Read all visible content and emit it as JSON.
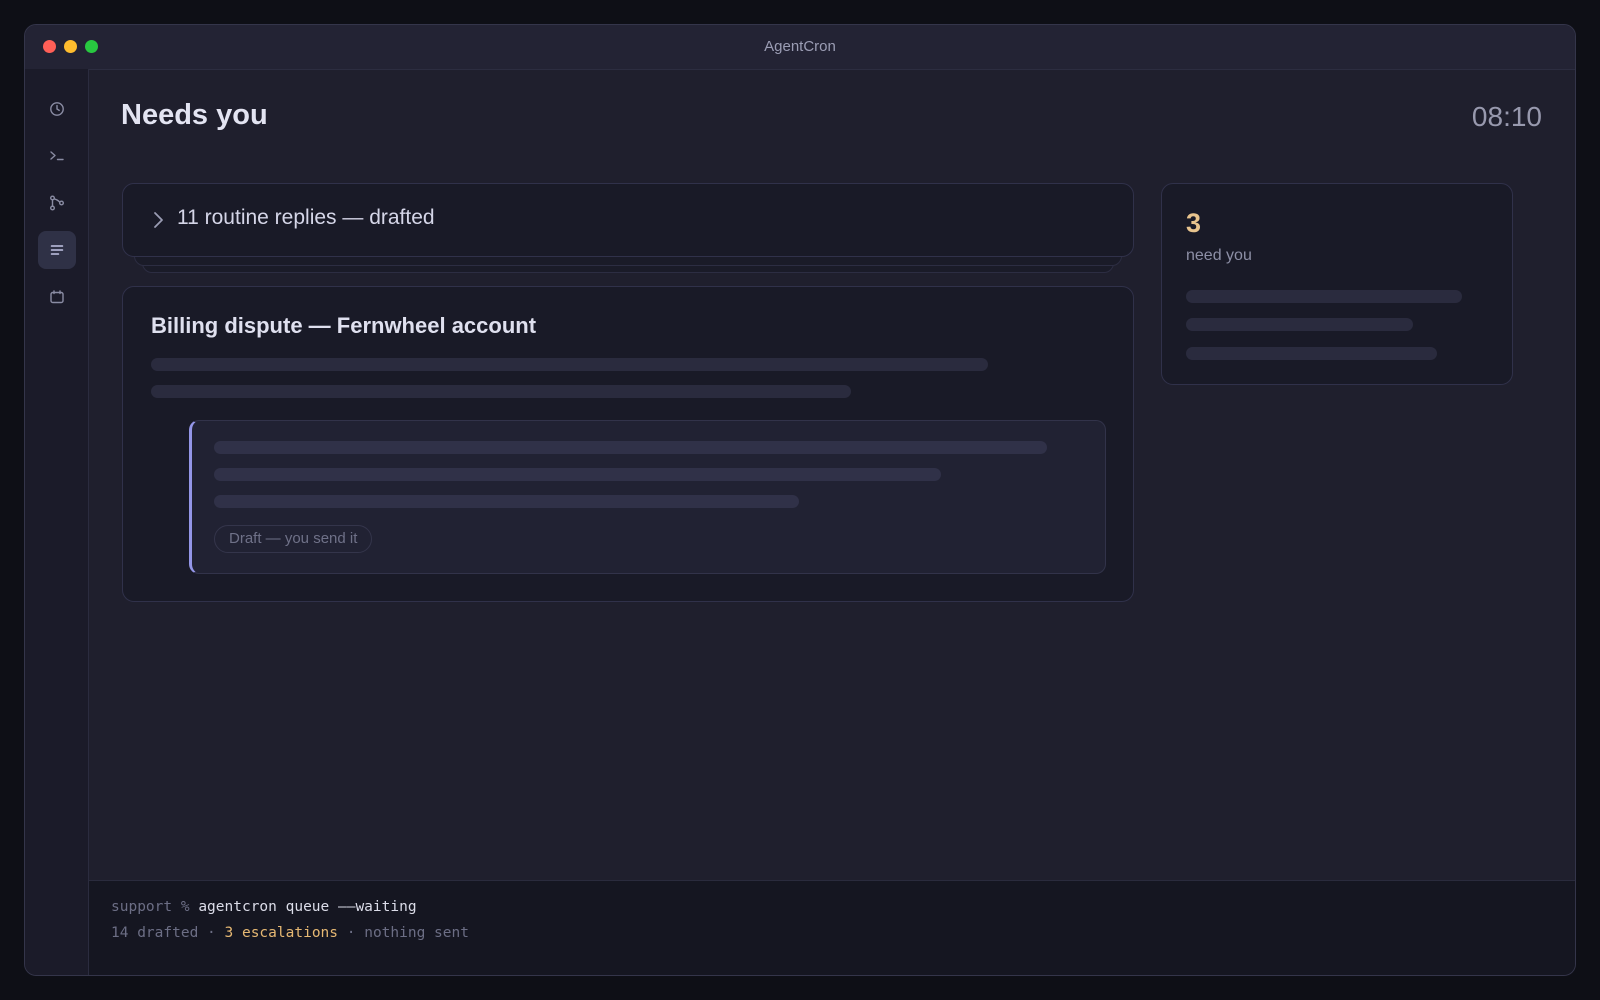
{
  "window": {
    "title": "AgentCron"
  },
  "sidebar": {
    "items": [
      {
        "name": "history",
        "icon": "clock-icon",
        "active": false
      },
      {
        "name": "terminal",
        "icon": "terminal-icon",
        "active": false
      },
      {
        "name": "workflows",
        "icon": "branch-icon",
        "active": false
      },
      {
        "name": "queue",
        "icon": "list-icon",
        "active": true
      },
      {
        "name": "calendar",
        "icon": "calendar-icon",
        "active": false
      }
    ]
  },
  "main": {
    "title": "Needs you",
    "time": "08:10",
    "collapsed_group": {
      "label": "11 routine replies — drafted"
    },
    "escalation": {
      "title": "Billing dispute — Fernwheel account",
      "draft_chip": "Draft — you send it"
    },
    "summary": {
      "count": "3",
      "label": "need you"
    }
  },
  "terminal": {
    "prompt": "support % ",
    "command": "agentcron queue ––waiting",
    "output": {
      "drafted": "14 drafted",
      "separator": " · ",
      "escalations": "3 escalations",
      "sent": "nothing sent"
    }
  },
  "colors": {
    "accent": "#9496e8",
    "amber": "#e8c48e",
    "background": "#1f1f2d"
  }
}
